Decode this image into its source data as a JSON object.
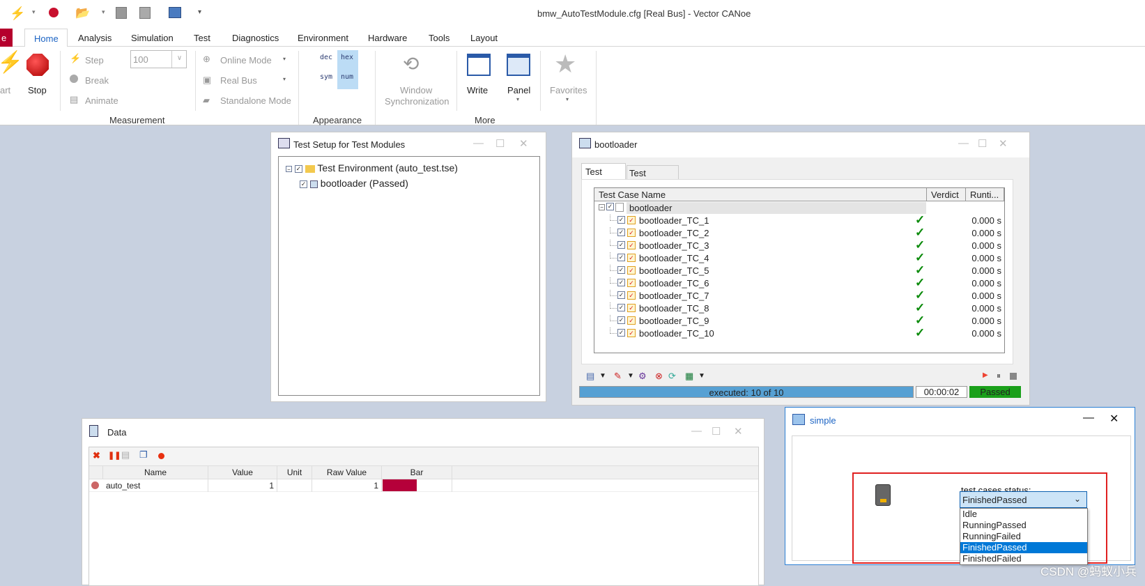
{
  "app": {
    "title": "bmw_AutoTestModule.cfg [Real Bus] - Vector CANoe"
  },
  "ribbon_tabs": [
    {
      "label": "e"
    },
    {
      "label": "Home"
    },
    {
      "label": "Analysis"
    },
    {
      "label": "Simulation"
    },
    {
      "label": "Test"
    },
    {
      "label": "Diagnostics"
    },
    {
      "label": "Environment"
    },
    {
      "label": "Hardware"
    },
    {
      "label": "Tools"
    },
    {
      "label": "Layout"
    }
  ],
  "ribbon": {
    "start": "art",
    "stop": "Stop",
    "step": "Step",
    "break": "Break",
    "animate": "Animate",
    "speed_value": "100",
    "online_mode": "Online Mode",
    "real_bus": "Real Bus",
    "standalone": "Standalone Mode",
    "measurement_group": "Measurement",
    "dec": "dec",
    "hex": "hex",
    "sym": "sym",
    "num": "num",
    "appearance_group": "Appearance",
    "window_sync_1": "Window",
    "window_sync_2": "Synchronization",
    "write": "Write",
    "panel": "Panel",
    "favorites": "Favorites",
    "more_group": "More"
  },
  "test_setup": {
    "title": "Test Setup for Test Modules",
    "environment": "Test Environment  (auto_test.tse)",
    "module": "bootloader (Passed)"
  },
  "bootloader": {
    "title": "bootloader",
    "tabs": [
      {
        "label": "Test Cases"
      },
      {
        "label": "Test Observer"
      }
    ],
    "columns": {
      "name": "Test Case Name",
      "verdict": "Verdict",
      "runtime": "Runti..."
    },
    "root": "bootloader",
    "cases": [
      {
        "name": "bootloader_TC_1",
        "verdict": "✓",
        "runtime": "0.000 s"
      },
      {
        "name": "bootloader_TC_2",
        "verdict": "✓",
        "runtime": "0.000 s"
      },
      {
        "name": "bootloader_TC_3",
        "verdict": "✓",
        "runtime": "0.000 s"
      },
      {
        "name": "bootloader_TC_4",
        "verdict": "✓",
        "runtime": "0.000 s"
      },
      {
        "name": "bootloader_TC_5",
        "verdict": "✓",
        "runtime": "0.000 s"
      },
      {
        "name": "bootloader_TC_6",
        "verdict": "✓",
        "runtime": "0.000 s"
      },
      {
        "name": "bootloader_TC_7",
        "verdict": "✓",
        "runtime": "0.000 s"
      },
      {
        "name": "bootloader_TC_8",
        "verdict": "✓",
        "runtime": "0.000 s"
      },
      {
        "name": "bootloader_TC_9",
        "verdict": "✓",
        "runtime": "0.000 s"
      },
      {
        "name": "bootloader_TC_10",
        "verdict": "✓",
        "runtime": "0.000 s"
      }
    ],
    "progress_text": "executed: 10 of 10",
    "progress": 1.0,
    "elapsed": "00:00:02",
    "status": "Passed",
    "colors": {
      "progress": "#56a0d3",
      "passed": "#1aa01a",
      "check": "#0a8a0a"
    }
  },
  "data_window": {
    "title": "Data",
    "columns": [
      "Name",
      "Value",
      "Unit",
      "Raw Value",
      "Bar"
    ],
    "rows": [
      {
        "name": "auto_test",
        "value": "1",
        "unit": "",
        "raw": "1",
        "bar_color": "#b5003a"
      }
    ]
  },
  "simple": {
    "title": "simple",
    "label": "test cases status:",
    "selected": "FinishedPassed",
    "options": [
      "Idle",
      "RunningPassed",
      "RunningFailed",
      "FinishedPassed",
      "FinishedFailed"
    ],
    "highlight_color": "#0078d7",
    "annotation_color": "#e02020"
  },
  "watermark": "CSDN @蚂蚁小兵"
}
